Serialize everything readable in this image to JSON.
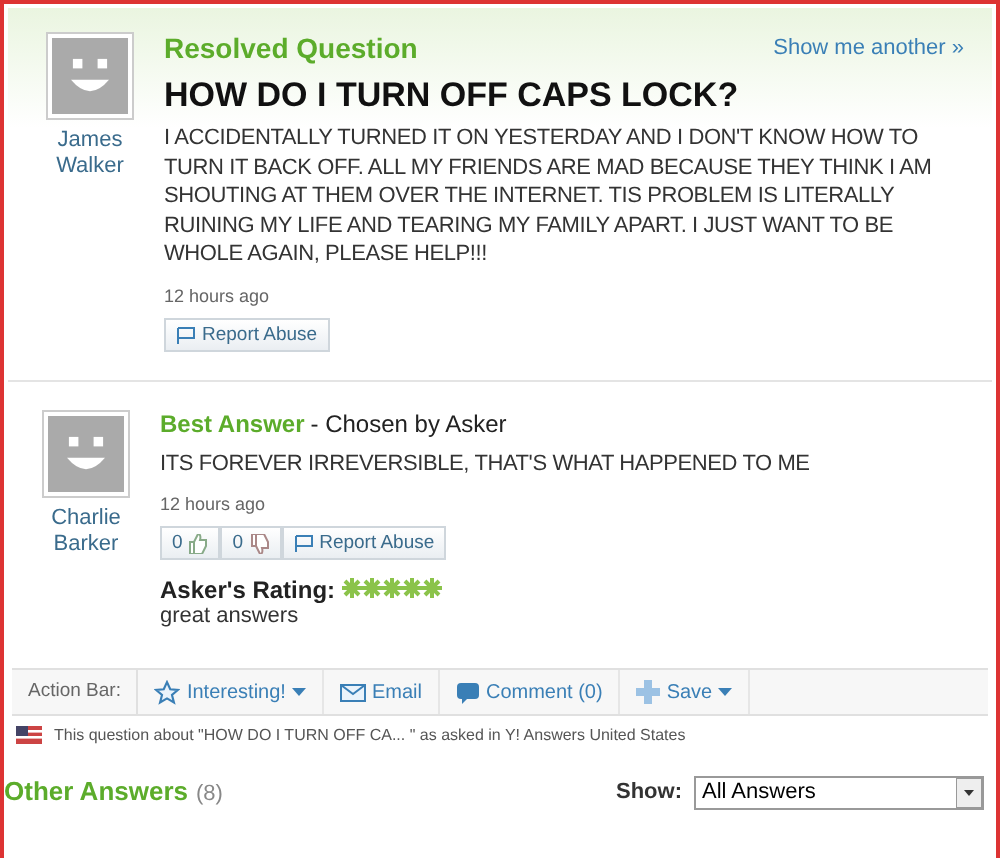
{
  "question": {
    "status": "Resolved Question",
    "show_another": "Show me another »",
    "author": "James Walker",
    "title": "HOW DO I TURN OFF CAPS LOCK?",
    "body": "I ACCIDENTALLY TURNED IT ON YESTERDAY AND I DON'T KNOW HOW TO TURN IT BACK OFF. ALL MY FRIENDS ARE MAD BECAUSE THEY THINK I AM SHOUTING AT THEM OVER THE INTERNET. TIS PROBLEM IS LITERALLY RUINING MY LIFE AND TEARING MY FAMILY APART. I JUST WANT TO BE WHOLE AGAIN, PLEASE HELP!!!",
    "time": "12 hours ago",
    "report": "Report Abuse"
  },
  "best_answer": {
    "label": "Best Answer",
    "chosen": "- Chosen by Asker",
    "author": "Charlie Barker",
    "body": "ITS FOREVER IRREVERSIBLE, THAT'S WHAT HAPPENED TO ME",
    "time": "12 hours ago",
    "thumbs_up": "0",
    "thumbs_down": "0",
    "report": "Report Abuse",
    "rating_label": "Asker's Rating:",
    "stars": 5,
    "comment": "great answers"
  },
  "action_bar": {
    "label": "Action Bar:",
    "actions": [
      {
        "kind": "star",
        "label": "Interesting!",
        "dropdown": true
      },
      {
        "kind": "email",
        "label": "Email",
        "dropdown": false
      },
      {
        "kind": "comment",
        "label": "Comment (0)",
        "dropdown": false
      },
      {
        "kind": "save",
        "label": "Save",
        "dropdown": true
      }
    ]
  },
  "notice": "This question about \"HOW DO I TURN OFF CA... \" as asked in Y! Answers United States",
  "other_answers": {
    "title": "Other Answers",
    "count": "(8)",
    "show_label": "Show:",
    "show_value": "All Answers"
  }
}
